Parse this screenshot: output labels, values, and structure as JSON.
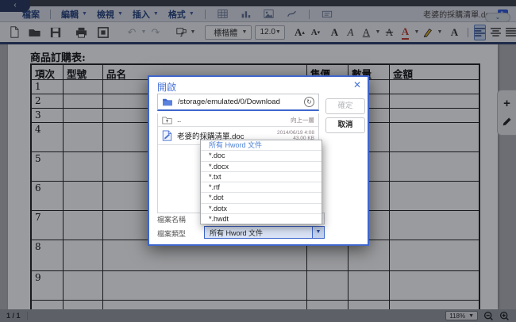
{
  "titlebar": {
    "back_label": "‹",
    "document_title": "老婆的採購清單.doc",
    "collapse_glyph": "⌄"
  },
  "menubar": {
    "items": [
      "檔案",
      "編輯",
      "檢視",
      "插入",
      "格式"
    ]
  },
  "toolbar": {
    "font_name": "標楷體",
    "font_size": "12.0",
    "increase_font": "A",
    "decrease_font": "A",
    "bold": "A",
    "italic": "A",
    "underline": "A",
    "strikethrough": "A",
    "font_color": "A",
    "char_style": "A",
    "accent_red": "#c0392b"
  },
  "document": {
    "heading": "商品訂購表:",
    "table": {
      "headers": [
        "項次",
        "型號",
        "品名",
        "售價",
        "數量",
        "金額"
      ],
      "row_numbers": [
        "1",
        "2",
        "3",
        "4",
        "5",
        "6",
        "7",
        "8",
        "9"
      ]
    }
  },
  "dialog": {
    "title": "開啟",
    "close_glyph": "✕",
    "path": "/storage/emulated/0/Download",
    "up_row": {
      "name": "..",
      "hint": "向上一層"
    },
    "file_row": {
      "name": "老婆的採購清單.doc",
      "date": "2014/06/19 4:08",
      "size": "43.00 KB"
    },
    "ok_label": "確定",
    "cancel_label": "取消",
    "filename_label": "檔案名稱",
    "filetype_label": "檔案類型",
    "filetype_value": "所有 Hword 文件",
    "dropdown_options": [
      "所有 Hword 文件",
      "*.doc",
      "*.docx",
      "*.txt",
      "*.rtf",
      "*.dot",
      "*.dotx",
      "*.hwdt"
    ],
    "accent_blue": "#3f66cc"
  },
  "statusbar": {
    "page_indicator": "1 / 1",
    "zoom_level": "118%"
  }
}
